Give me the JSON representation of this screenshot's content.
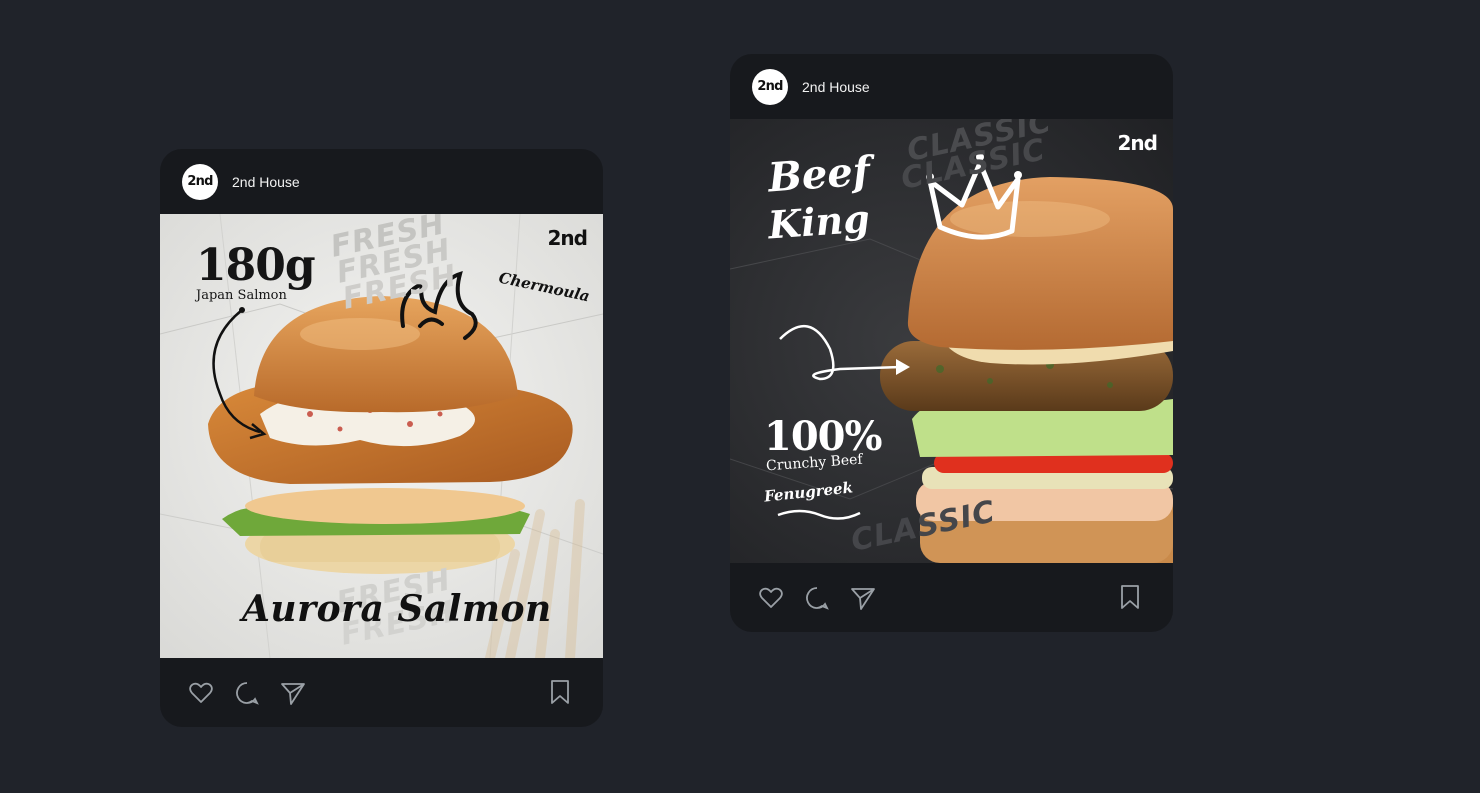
{
  "posts": [
    {
      "account": {
        "avatar_text": "2nd",
        "name": "2nd House"
      },
      "image": {
        "brand": "2nd",
        "weight": "180g",
        "weight_caption": "Japan Salmon",
        "sauce": "Chermoula",
        "title": "Aurora Salmon",
        "background_word": "FRESH"
      },
      "actions": {
        "like_icon": "heart-icon",
        "comment_icon": "comment-icon",
        "share_icon": "send-icon",
        "save_icon": "bookmark-icon"
      }
    },
    {
      "account": {
        "avatar_text": "2nd",
        "name": "2nd House"
      },
      "image": {
        "brand": "2nd",
        "title_line1": "Beef",
        "title_line2": "King",
        "percent": "100%",
        "percent_caption": "Crunchy Beef",
        "spice": "Fenugreek",
        "background_word": "CLASSIC"
      },
      "actions": {
        "like_icon": "heart-icon",
        "comment_icon": "comment-icon",
        "share_icon": "send-icon",
        "save_icon": "bookmark-icon"
      }
    }
  ],
  "colors": {
    "page_background": "#20232a",
    "card_background": "#17191d",
    "card1_paper": "#ebebeb",
    "card2_paper": "#2a2b2e"
  }
}
